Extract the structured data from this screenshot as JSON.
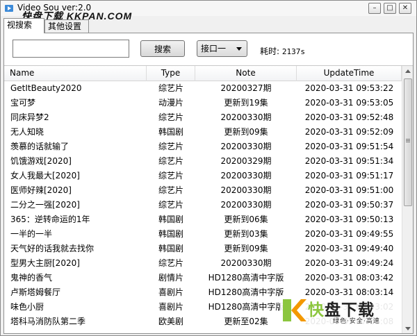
{
  "window": {
    "title": "Video Sou ver:2.0",
    "watermark": "快盘下载 KKPAN.COM",
    "controls": {
      "minimize": "–",
      "maximize": "□",
      "close": "✕"
    }
  },
  "tabs": [
    {
      "label": "视搜索",
      "active": true
    },
    {
      "label": "其他设置",
      "active": false
    }
  ],
  "search": {
    "value": "",
    "placeholder": "",
    "button_label": "搜索",
    "source_select": "接口一",
    "elapsed_label": "耗时:",
    "elapsed_value": "2137s"
  },
  "table": {
    "columns": [
      "Name",
      "Type",
      "Note",
      "UpdateTime"
    ],
    "rows": [
      {
        "name": "GetItBeauty2020",
        "type": "综艺片",
        "note": "20200327期",
        "time": "2020-03-31 09:53:22"
      },
      {
        "name": "宝可梦",
        "type": "动漫片",
        "note": "更新到19集",
        "time": "2020-03-31 09:53:05"
      },
      {
        "name": "同床异梦2",
        "type": "综艺片",
        "note": "20200330期",
        "time": "2020-03-31 09:52:48"
      },
      {
        "name": "无人知晓",
        "type": "韩国剧",
        "note": "更新到09集",
        "time": "2020-03-31 09:52:09"
      },
      {
        "name": "羡慕的话就输了",
        "type": "综艺片",
        "note": "20200330期",
        "time": "2020-03-31 09:51:54"
      },
      {
        "name": "饥饿游戏[2020]",
        "type": "综艺片",
        "note": "20200329期",
        "time": "2020-03-31 09:51:34"
      },
      {
        "name": "女人我最大[2020]",
        "type": "综艺片",
        "note": "20200330期",
        "time": "2020-03-31 09:51:17"
      },
      {
        "name": "医师好辣[2020]",
        "type": "综艺片",
        "note": "20200330期",
        "time": "2020-03-31 09:51:00"
      },
      {
        "name": "二分之一强[2020]",
        "type": "综艺片",
        "note": "20200330期",
        "time": "2020-03-31 09:50:37"
      },
      {
        "name": "365：逆转命运的1年",
        "type": "韩国剧",
        "note": "更新到06集",
        "time": "2020-03-31 09:50:13"
      },
      {
        "name": "一半的一半",
        "type": "韩国剧",
        "note": "更新到03集",
        "time": "2020-03-31 09:49:55"
      },
      {
        "name": "天气好的话我就去找你",
        "type": "韩国剧",
        "note": "更新到09集",
        "time": "2020-03-31 09:49:40"
      },
      {
        "name": "型男大主厨[2020]",
        "type": "综艺片",
        "note": "20200330期",
        "time": "2020-03-31 09:49:24"
      },
      {
        "name": "鬼神的香气",
        "type": "剧情片",
        "note": "HD1280高清中字版",
        "time": "2020-03-31 08:03:42"
      },
      {
        "name": "卢斯塔姆餐厅",
        "type": "喜剧片",
        "note": "HD1280高清中字版",
        "time": "2020-03-31 08:03:14"
      },
      {
        "name": "味色小厨",
        "type": "喜剧片",
        "note": "HD1280高清中字版",
        "time": "2020-03-31 08:03:02"
      },
      {
        "name": "塔科马消防队第二季",
        "type": "欧美剧",
        "note": "更新至02集",
        "time": "2020-03-31 07:56:08"
      }
    ]
  },
  "logo": {
    "main_accent": "快",
    "main_rest": "盘下载",
    "sub": "绿色·安全·高速"
  }
}
